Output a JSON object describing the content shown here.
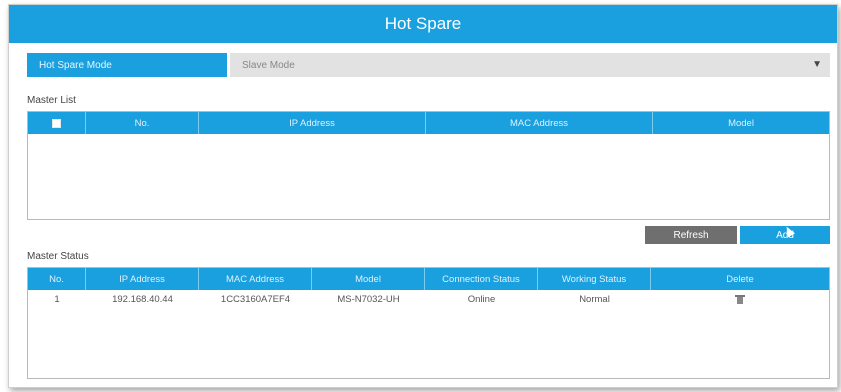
{
  "window": {
    "title": "Hot Spare"
  },
  "mode": {
    "label": "Hot Spare Mode",
    "value": "Slave Mode"
  },
  "master_list": {
    "title": "Master List",
    "columns": [
      "No.",
      "IP Address",
      "MAC Address",
      "Model"
    ]
  },
  "buttons": {
    "refresh": "Refresh",
    "add": "Add"
  },
  "master_status": {
    "title": "Master Status",
    "columns": [
      "No.",
      "IP Address",
      "MAC Address",
      "Model",
      "Connection Status",
      "Working Status",
      "Delete"
    ],
    "rows": [
      {
        "no": "1",
        "ip": "192.168.40.44",
        "mac": "1CC3160A7EF4",
        "model": "MS-N7032-UH",
        "connection": "Online",
        "working": "Normal"
      }
    ]
  },
  "colors": {
    "accent": "#1aa0de",
    "refresh_button": "#6f6f6f"
  }
}
